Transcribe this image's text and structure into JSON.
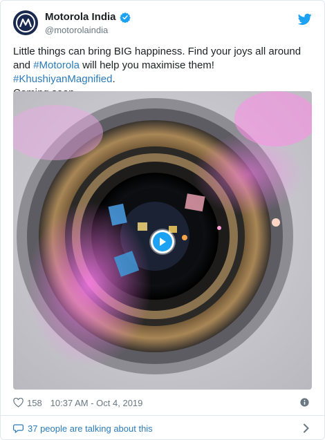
{
  "author": {
    "display_name": "Motorola India",
    "handle": "@motorolaindia",
    "verified": true,
    "avatar_icon": "motorola-logo"
  },
  "tweet": {
    "text_parts": [
      {
        "t": "Little things can bring BIG happiness. Find your joys all around and "
      },
      {
        "t": "#Motorola"
      },
      {
        "t": " will help you maximise them! "
      },
      {
        "t": "#KhushiyanMagnified"
      },
      {
        "t": "."
      },
      {
        "t": "Coming soon."
      }
    ],
    "media": {
      "type": "video",
      "subject": "camera lens close-up",
      "icon": "play-icon"
    }
  },
  "meta": {
    "like_count": "158",
    "timestamp": "10:37 AM - Oct 4, 2019",
    "like_icon": "heart-icon",
    "info_icon": "info-icon"
  },
  "footer": {
    "label": "37 people are talking about this",
    "icon": "comment-bubble-icon",
    "chevron_icon": "chevron-right-icon"
  },
  "colors": {
    "link": "#2b7bb9",
    "twitter_blue": "#1da1f2",
    "muted": "#697882",
    "border": "#e1e8ed"
  }
}
